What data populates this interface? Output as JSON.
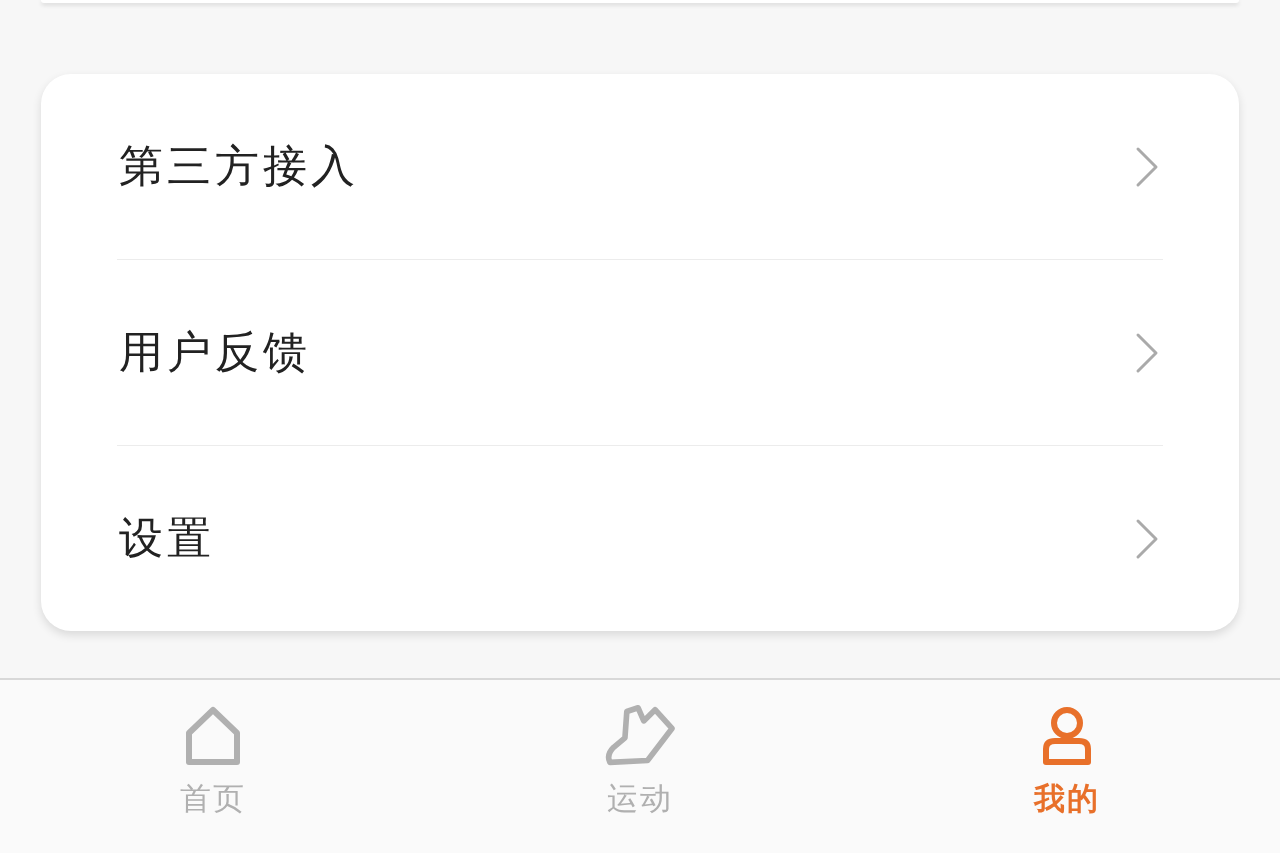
{
  "menu": [
    {
      "label": "第三方接入"
    },
    {
      "label": "用户反馈"
    },
    {
      "label": "设置"
    }
  ],
  "tabs": [
    {
      "label": "首页",
      "selected": false
    },
    {
      "label": "运动",
      "selected": false
    },
    {
      "label": "我的",
      "selected": true
    }
  ]
}
